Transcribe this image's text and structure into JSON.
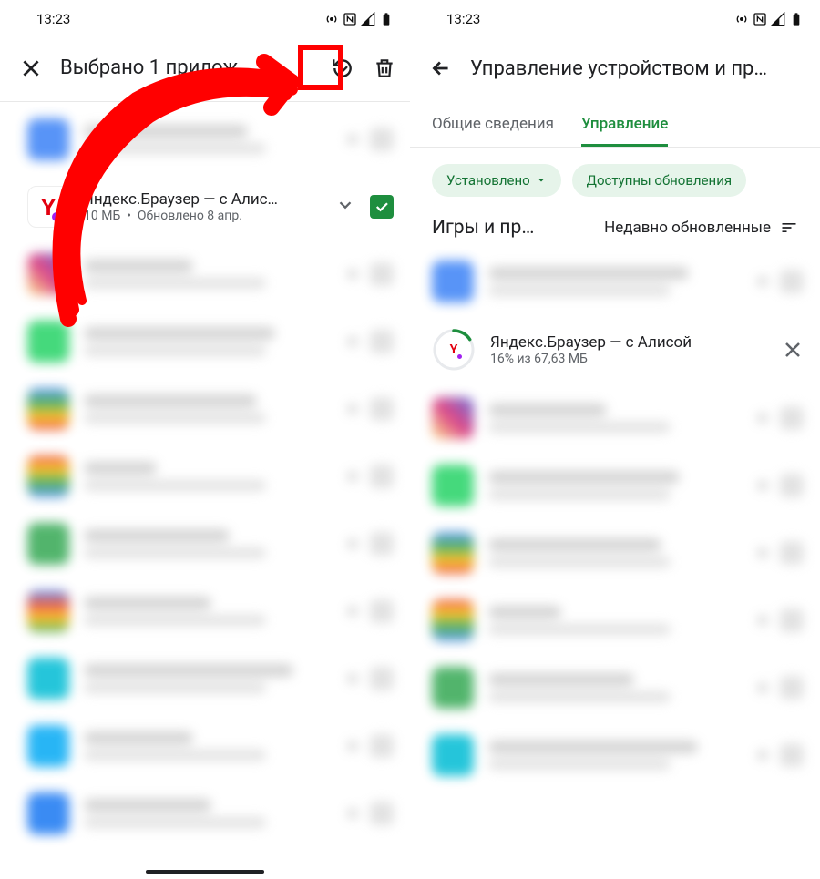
{
  "status": {
    "time": "13:23"
  },
  "left": {
    "title": "Выбрано 1 прилож…",
    "selected_app": {
      "name": "Яндекс.Браузер — с Алис…",
      "sub_prefix_size": "МБ",
      "sub": "Обновлено 8 апр.",
      "size_partial": "10"
    }
  },
  "right": {
    "title": "Управление устройством и пр…",
    "tabs": {
      "overview": "Общие сведения",
      "manage": "Управление"
    },
    "chips": {
      "installed": "Установлено",
      "updates": "Доступны обновления"
    },
    "section_title": "Игры и пр…",
    "sort_label": "Недавно обновленные",
    "downloading": {
      "name": "Яндекс.Браузер — с Алисой",
      "progress_text": "16% из 67,63 МБ",
      "progress_percent": 16
    }
  },
  "blurred_colors_left": [
    "#3b82f6",
    "#e1306c",
    "#25d366",
    "#4285f4",
    "#ea4335",
    "#34a853",
    "#00bcd4",
    "#03a9f4",
    "#1877f2"
  ],
  "blurred_colors_right": [
    "#3b82f6",
    "#e1306c",
    "#25d366",
    "#4285f4",
    "#ea4335",
    "#34a853",
    "#00bcd4"
  ]
}
